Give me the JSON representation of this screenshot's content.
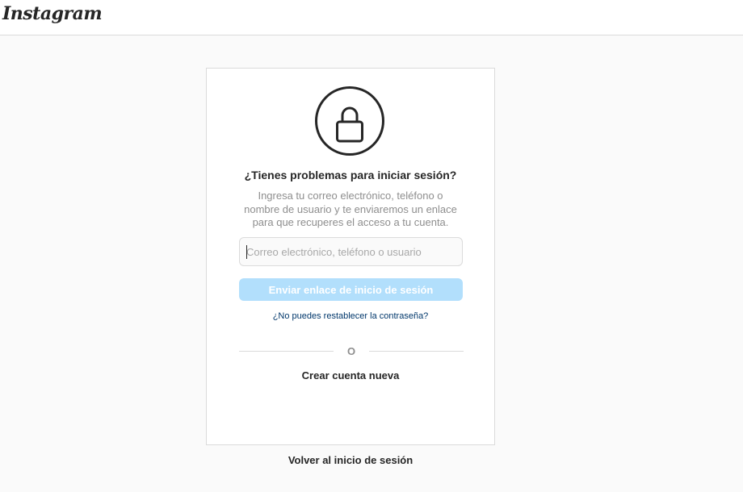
{
  "header": {
    "logo_text": "Instagram"
  },
  "recovery": {
    "icon": "lock-icon",
    "title": "¿Tienes problemas para iniciar sesión?",
    "description": "Ingresa tu correo electrónico, teléfono o nombre de usuario y te enviaremos un enlace para que recuperes el acceso a tu cuenta.",
    "input": {
      "placeholder": "Correo electrónico, teléfono o usuario",
      "value": ""
    },
    "send_button_label": "Enviar enlace de inicio de sesión",
    "forgot_password_link": "¿No puedes restablecer la contraseña?",
    "divider_text": "O",
    "create_account_link": "Crear cuenta nueva",
    "back_to_login_label": "Volver al inicio de sesión"
  },
  "colors": {
    "background": "#fafafa",
    "border": "#dbdbdb",
    "button_disabled": "#b2dffc",
    "link": "#00376b",
    "text_primary": "#262626",
    "text_secondary": "#8e8e8e"
  }
}
